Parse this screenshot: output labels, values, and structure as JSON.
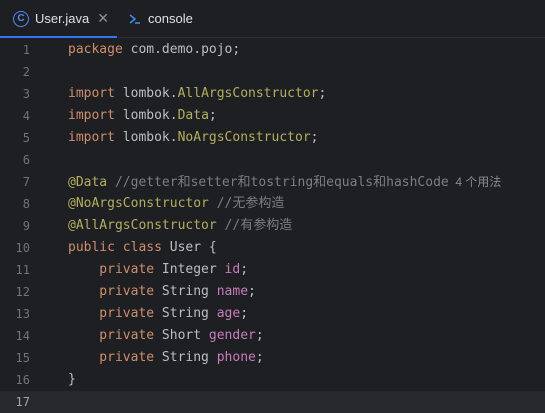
{
  "tabs": [
    {
      "label": "User.java",
      "icon": "class-icon",
      "icon_letter": "C",
      "active": true,
      "closable": true
    },
    {
      "label": "console",
      "icon": "console-icon",
      "active": false
    }
  ],
  "accent": "#3574f0",
  "editor": {
    "current_line": 17,
    "line_numbers": [
      "1",
      "2",
      "3",
      "4",
      "5",
      "6",
      "7",
      "8",
      "9",
      "10",
      "11",
      "12",
      "13",
      "14",
      "15",
      "16",
      "17"
    ],
    "lines": [
      [
        {
          "t": "package ",
          "c": "kw"
        },
        {
          "t": "com.demo.pojo;",
          "c": "cls"
        }
      ],
      [],
      [
        {
          "t": "import ",
          "c": "kw"
        },
        {
          "t": "lombok.",
          "c": "cls"
        },
        {
          "t": "AllArgsConstructor",
          "c": "imp"
        },
        {
          "t": ";",
          "c": "cls"
        }
      ],
      [
        {
          "t": "import ",
          "c": "kw"
        },
        {
          "t": "lombok.",
          "c": "cls"
        },
        {
          "t": "Data",
          "c": "imp"
        },
        {
          "t": ";",
          "c": "cls"
        }
      ],
      [
        {
          "t": "import ",
          "c": "kw"
        },
        {
          "t": "lombok.",
          "c": "cls"
        },
        {
          "t": "NoArgsConstructor",
          "c": "imp"
        },
        {
          "t": ";",
          "c": "cls"
        }
      ],
      [],
      [
        {
          "t": "@Data ",
          "c": "ann"
        },
        {
          "t": "//getter和setter和tostring和equals和hashCode",
          "c": "cm"
        },
        {
          "t": "  4 个用法",
          "c": "hint"
        }
      ],
      [
        {
          "t": "@NoArgsConstructor ",
          "c": "ann"
        },
        {
          "t": "//无参构造",
          "c": "cm"
        }
      ],
      [
        {
          "t": "@AllArgsConstructor ",
          "c": "ann"
        },
        {
          "t": "//有参构造",
          "c": "cm"
        }
      ],
      [
        {
          "t": "public class ",
          "c": "kw"
        },
        {
          "t": "User {",
          "c": "cls"
        }
      ],
      [
        {
          "t": "    private ",
          "c": "kw"
        },
        {
          "t": "Integer ",
          "c": "cls"
        },
        {
          "t": "id",
          "c": "field"
        },
        {
          "t": ";",
          "c": "cls"
        }
      ],
      [
        {
          "t": "    private ",
          "c": "kw"
        },
        {
          "t": "String ",
          "c": "cls"
        },
        {
          "t": "name",
          "c": "field"
        },
        {
          "t": ";",
          "c": "cls"
        }
      ],
      [
        {
          "t": "    private ",
          "c": "kw"
        },
        {
          "t": "String ",
          "c": "cls"
        },
        {
          "t": "age",
          "c": "field"
        },
        {
          "t": ";",
          "c": "cls"
        }
      ],
      [
        {
          "t": "    private ",
          "c": "kw"
        },
        {
          "t": "Short ",
          "c": "cls"
        },
        {
          "t": "gender",
          "c": "field"
        },
        {
          "t": ";",
          "c": "cls"
        }
      ],
      [
        {
          "t": "    private ",
          "c": "kw"
        },
        {
          "t": "String ",
          "c": "cls"
        },
        {
          "t": "phone",
          "c": "field"
        },
        {
          "t": ";",
          "c": "cls"
        }
      ],
      [
        {
          "t": "}",
          "c": "cls"
        }
      ],
      []
    ]
  }
}
